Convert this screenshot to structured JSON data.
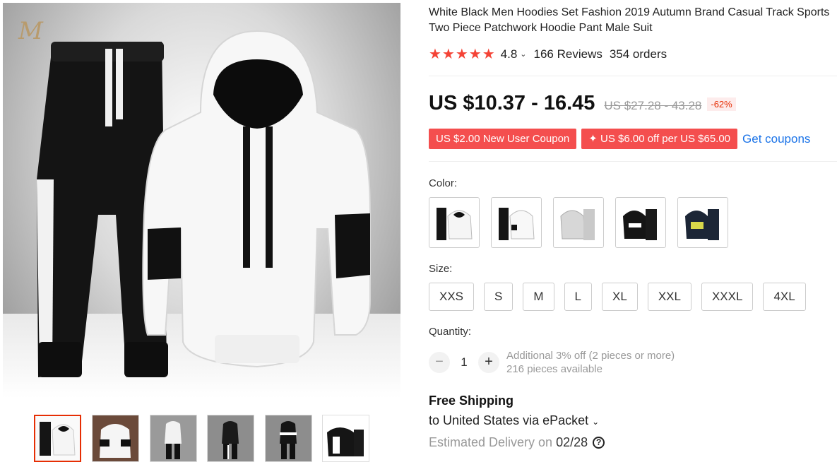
{
  "product": {
    "title": "White Black Men Hoodies Set Fashion 2019 Autumn Brand Casual Track Sports Two Piece Patchwork Hoodie Pant Male Suit",
    "brand_logo": "M"
  },
  "rating": {
    "stars": "★★★★★",
    "value": "4.8",
    "chevron": "⌄",
    "reviews": "166 Reviews",
    "orders": "354 orders"
  },
  "price": {
    "current": "US $10.37 - 16.45",
    "original": "US $27.28 - 43.28",
    "discount": "-62%"
  },
  "coupons": {
    "new_user": "US $2.00 New User Coupon",
    "store": "✦ US $6.00 off per US $65.00",
    "get_link": "Get coupons"
  },
  "color": {
    "label": "Color:",
    "options": [
      "white-black set",
      "white set 2",
      "grey set",
      "black set",
      "navy set"
    ]
  },
  "size": {
    "label": "Size:",
    "options": [
      "XXS",
      "S",
      "M",
      "L",
      "XL",
      "XXL",
      "XXXL",
      "4XL"
    ]
  },
  "quantity": {
    "label": "Quantity:",
    "minus": "−",
    "plus": "+",
    "value": "1",
    "note_discount": "Additional 3% off (2 pieces or more)",
    "note_available": "216 pieces available"
  },
  "shipping": {
    "title": "Free Shipping",
    "to": "to United States via ePacket",
    "chevron": "⌄",
    "delivery_label": "Estimated Delivery on",
    "delivery_date": "02/28",
    "help_icon": "?"
  },
  "colors_palette": {
    "accent": "#f44e4e",
    "star": "#f44336",
    "link": "#1a73e8",
    "active_thumb": "#e62e04"
  }
}
